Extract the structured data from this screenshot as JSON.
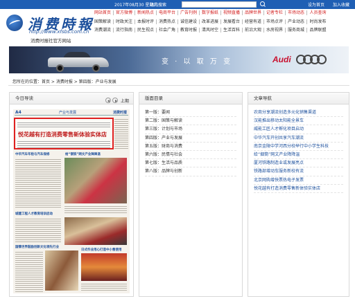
{
  "topbar": {
    "date": "2017年08月30 星期三",
    "site_nav": "站内搜索",
    "set_home": "设为首页",
    "add_favorite": "加入收藏"
  },
  "header": {
    "logo_title": "消费時報",
    "logo_url": "http://www.xfsbs.com.cn",
    "logo_sub": "消费时报社官方网站"
  },
  "nav": {
    "row1": [
      "网站首页",
      "官方微博",
      "新闻热点",
      "电商平台",
      "广告刊例",
      "数字报纸",
      "视频直播",
      "品牌世界",
      "记者专栏",
      "市场动态",
      "人员查询"
    ],
    "row2": [
      "国策解读",
      "时政关注",
      "本报时评",
      "消费热点",
      "诚信建设",
      "改革进展",
      "发展看台",
      "经营有道",
      "市场点评",
      "产业动态",
      "时尚发布"
    ],
    "row3": [
      "消费潮流",
      "流行指南",
      "民生视点",
      "社会广角",
      "教育时报",
      "清风时空",
      "生活百科",
      "前沿大观",
      "水房视界",
      "服务商城",
      "品牌联盟"
    ]
  },
  "banner": {
    "slogan": "变 · 以 取 万 变",
    "brand": "Audi"
  },
  "breadcrumb": "您所在的位置：首页 > 消费时报 > 第四版：产业与发展",
  "left_panel": {
    "title": "今日导读",
    "prev": "上期",
    "paper": {
      "page_no": "A4",
      "section": "产业与发展",
      "paper_name": "消费时报",
      "headline": "悦花越有打造消费零售新体验实体店",
      "sub1": "中华汽车年检与汽车保修",
      "sub2": "给“钢铁”网文产业降降温",
      "sub3": "城建工程人才教育培训启动",
      "sub4": "国情世界鼓励创新文化领先行业",
      "sub5": "日式作业用心打造中小售使用"
    }
  },
  "mid_panel": {
    "title": "版面目录",
    "items": [
      "第一版：要闻",
      "第二版：国策与解读",
      "第三版：计划与市场",
      "第四版：产业与发展",
      "第五版：财商与消费",
      "第六版：民情与社会",
      "第七版：生活与品质",
      "第八版：品牌与创新"
    ]
  },
  "right_panel": {
    "title": "文章导航",
    "items": [
      "农商分享潮流创造多元化销售渠道",
      "汉能推出移动太阳能全景车",
      "威能工匠人才孵化项目启动",
      "中华汽车开创共享汽车潮流",
      "南京金陵中学河西分校举行中小学生科技",
      "给“烟筒”网文产业降降温",
      "厦河铁路制造业或发展亮点",
      "铁路部增动车服务新校有流",
      "北京网购增快票热电子发票",
      "悦花越有打造消费零售新体验实体店"
    ]
  }
}
